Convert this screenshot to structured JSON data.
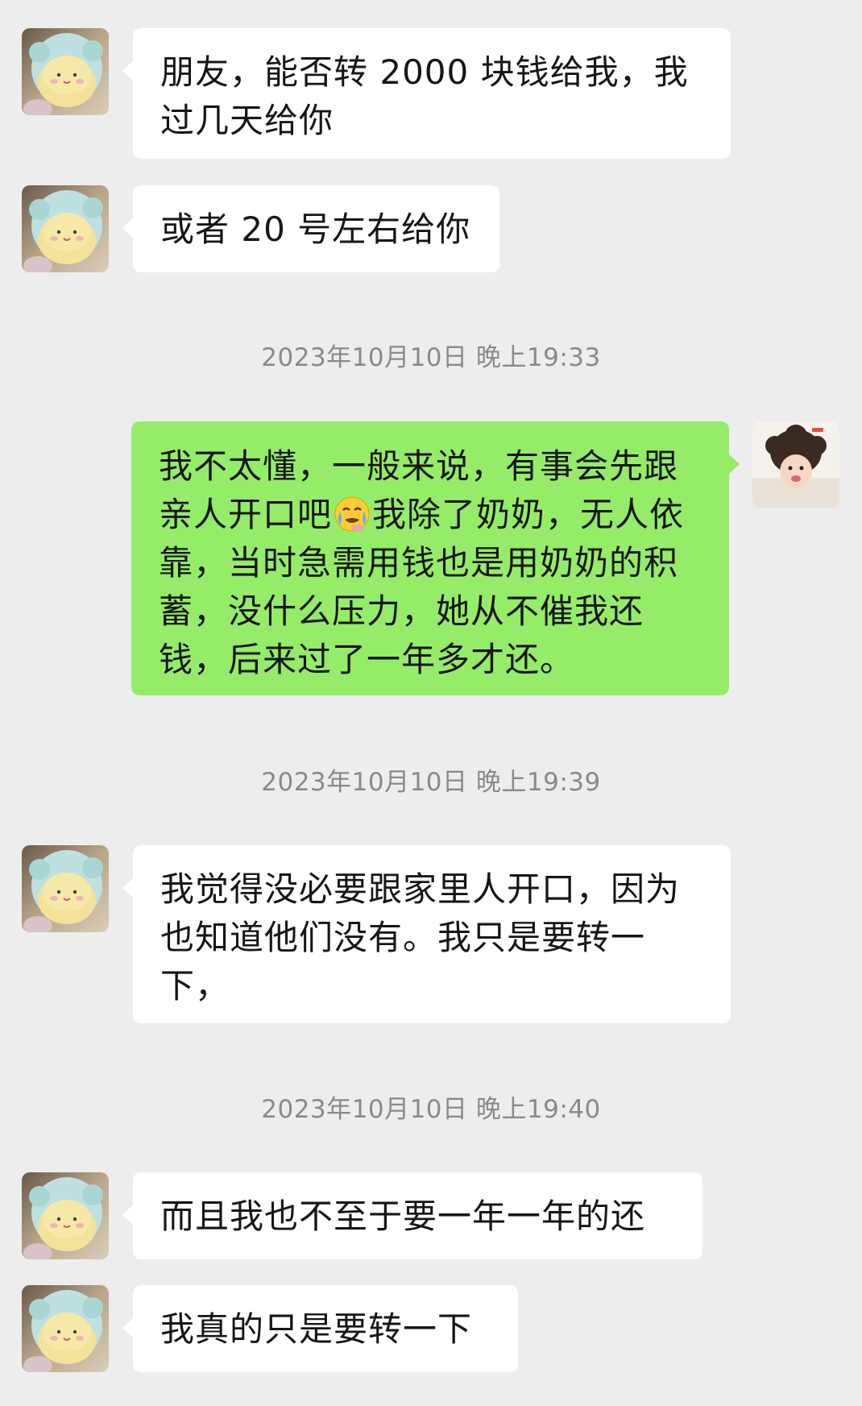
{
  "messages": [
    {
      "text": "朋友，能否转 2000 块钱给我，我过几天给你"
    },
    {
      "text": "或者 20 号左右给你"
    },
    {
      "timestamp": "2023年10月10日 晚上19:33"
    },
    {
      "text_part1": "我不太懂，一般来说，有事会先跟亲人开口吧",
      "emoji": "crying-face-emoji",
      "text_part2": "我除了奶奶，无人依靠，当时急需用钱也是用奶奶的积蓄，没什么压力，她从不催我还钱，后来过了一年多才还。"
    },
    {
      "timestamp": "2023年10月10日 晚上19:39"
    },
    {
      "text": "我觉得没必要跟家里人开口，因为也知道他们没有。我只是要转一下，"
    },
    {
      "timestamp": "2023年10月10日 晚上19:40"
    },
    {
      "text": "而且我也不至于要一年一年的还"
    },
    {
      "text": "我真的只是要转一下"
    }
  ],
  "colors": {
    "background": "#ededed",
    "incoming_bubble": "#ffffff",
    "outgoing_bubble": "#95ec69",
    "timestamp_text": "#8a8a8a"
  },
  "icons": {
    "friend_avatar": "plush-toy-avatar",
    "self_avatar": "baby-photo-avatar"
  }
}
